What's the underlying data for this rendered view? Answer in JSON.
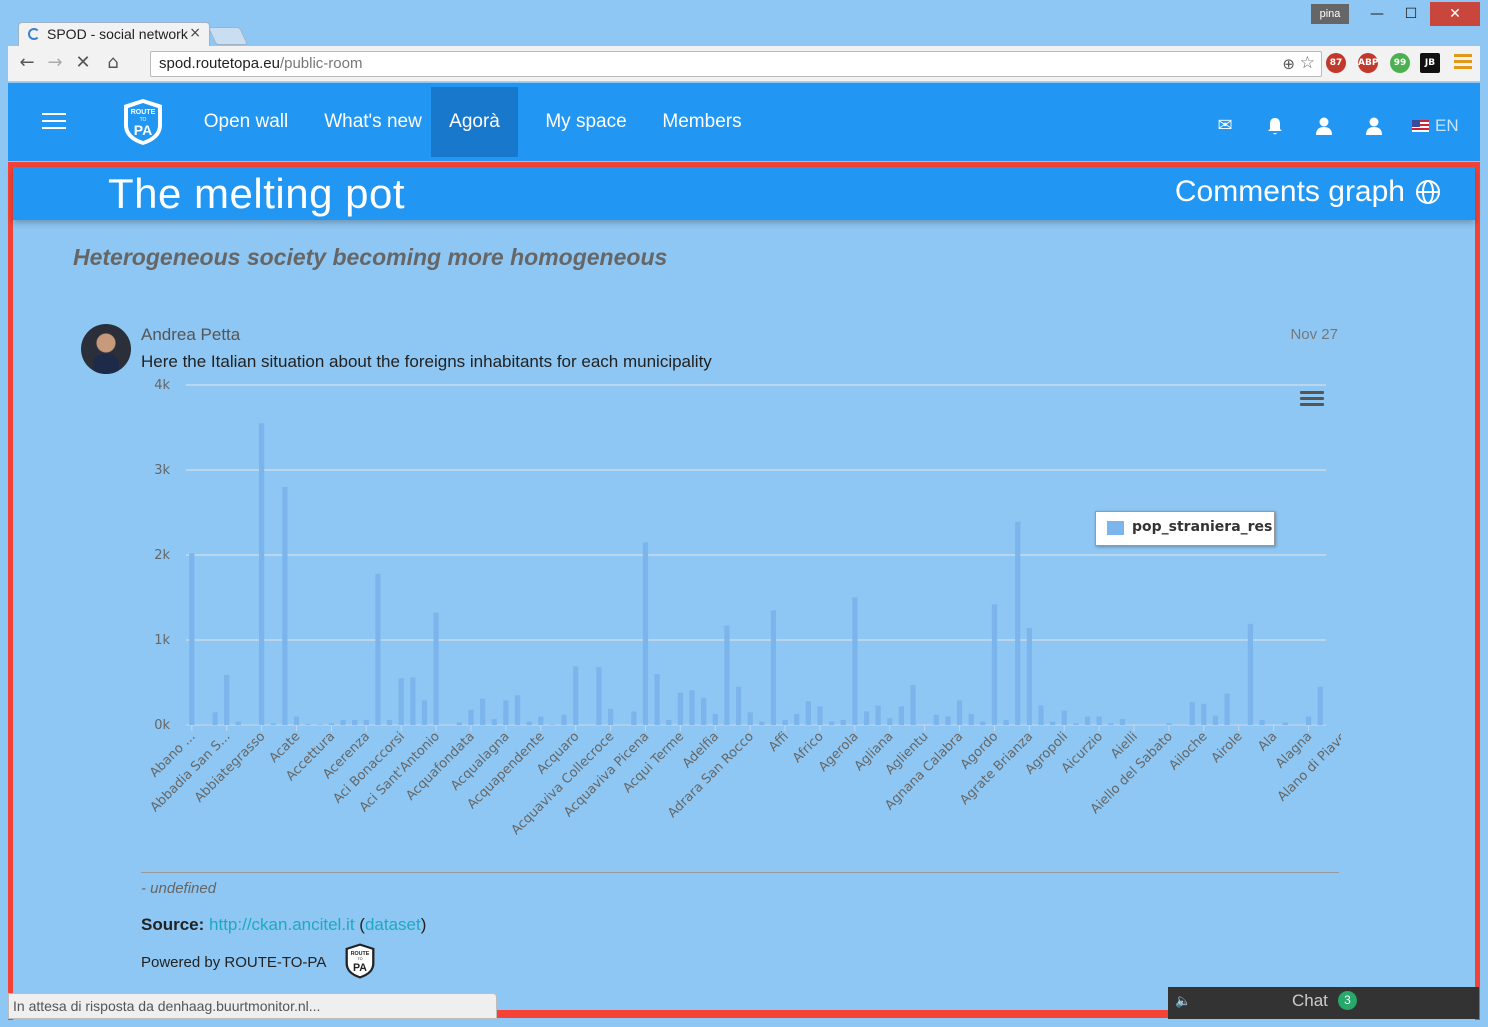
{
  "browser": {
    "tab_title": "SPOD - social network",
    "tab_close": "×",
    "profile": "pina",
    "min": "—",
    "max": "☐",
    "close": "✕",
    "back": "←",
    "forward": "→",
    "reload": "✕",
    "home": "⌂",
    "url_host": "spod.routetopa.eu",
    "url_path": "/public-room",
    "extensions": [
      {
        "name": "extension-87-icon",
        "label": "87",
        "color": "#c0392b"
      },
      {
        "name": "adblock-icon",
        "label": "ABP",
        "color": "#c0392b"
      },
      {
        "name": "evernote-icon",
        "label": "99",
        "color": "#4caf50"
      },
      {
        "name": "jb-icon",
        "label": "JB",
        "color": "#111111"
      }
    ]
  },
  "header": {
    "nav": [
      "Open wall",
      "What's new",
      "Agorà",
      "My space",
      "Members"
    ],
    "active_index": 2,
    "lang": "EN"
  },
  "room": {
    "title": "The melting pot",
    "graph_label": "Comments graph",
    "subtitle": "Heterogeneous society becoming more homogeneous"
  },
  "post": {
    "author": "Andrea Petta",
    "date": "Nov 27",
    "text": "Here the Italian situation about the foreigns inhabitants for each municipality"
  },
  "chart_data": {
    "type": "bar",
    "y_ticks": [
      "0k",
      "1k",
      "2k",
      "3k",
      "4k"
    ],
    "ylim": [
      0,
      4000
    ],
    "grid": true,
    "legend_position": "top-right",
    "colors": {
      "bar": "#7cb5ec"
    },
    "series": [
      {
        "name": "pop_straniera_res",
        "values": [
          2020,
          0,
          150,
          590,
          40,
          0,
          3550,
          20,
          2800,
          100,
          10,
          5,
          20,
          60,
          60,
          60,
          1780,
          60,
          550,
          560,
          290,
          1320,
          0,
          30,
          180,
          310,
          70,
          290,
          350,
          40,
          100,
          5,
          120,
          690,
          0,
          680,
          190,
          0,
          160,
          2150,
          600,
          60,
          380,
          410,
          320,
          130,
          1170,
          450,
          150,
          40,
          1350,
          60,
          130,
          280,
          220,
          40,
          60,
          1500,
          160,
          230,
          80,
          220,
          470,
          0,
          120,
          100,
          290,
          130,
          40,
          1420,
          60,
          2390,
          1140,
          230,
          40,
          170,
          20,
          100,
          100,
          20,
          70,
          0,
          0,
          0,
          20,
          0,
          270,
          250,
          110,
          370,
          0,
          1190,
          60,
          0,
          30,
          0,
          100,
          450
        ]
      }
    ],
    "x_tick_labels": [
      {
        "i": 0,
        "label": "Abano ..."
      },
      {
        "i": 3,
        "label": "Abbadia San S..."
      },
      {
        "i": 6,
        "label": "Abbiategrasso"
      },
      {
        "i": 9,
        "label": "Acate"
      },
      {
        "i": 12,
        "label": "Accettura"
      },
      {
        "i": 15,
        "label": "Acerenza"
      },
      {
        "i": 18,
        "label": "Aci Bonaccorsi"
      },
      {
        "i": 21,
        "label": "Aci Sant'Antonio"
      },
      {
        "i": 24,
        "label": "Acquafondata"
      },
      {
        "i": 27,
        "label": "Acqualagna"
      },
      {
        "i": 30,
        "label": "Acquapendente"
      },
      {
        "i": 33,
        "label": "Acquaro"
      },
      {
        "i": 36,
        "label": "Acquaviva Collecroce"
      },
      {
        "i": 39,
        "label": "Acquaviva Picena"
      },
      {
        "i": 42,
        "label": "Acqui Terme"
      },
      {
        "i": 45,
        "label": "Adelfia"
      },
      {
        "i": 48,
        "label": "Adrara San Rocco"
      },
      {
        "i": 51,
        "label": "Affi"
      },
      {
        "i": 54,
        "label": "Africo"
      },
      {
        "i": 57,
        "label": "Agerola"
      },
      {
        "i": 60,
        "label": "Agliana"
      },
      {
        "i": 63,
        "label": "Aglientu"
      },
      {
        "i": 66,
        "label": "Agnana Calabra"
      },
      {
        "i": 69,
        "label": "Agordo"
      },
      {
        "i": 72,
        "label": "Agrate Brianza"
      },
      {
        "i": 75,
        "label": "Agropoli"
      },
      {
        "i": 78,
        "label": "Aicurzio"
      },
      {
        "i": 81,
        "label": "Aielli"
      },
      {
        "i": 84,
        "label": "Aiello del Sabato"
      },
      {
        "i": 87,
        "label": "Ailoche"
      },
      {
        "i": 90,
        "label": "Airole"
      },
      {
        "i": 93,
        "label": "Ala"
      },
      {
        "i": 96,
        "label": "Alagna"
      },
      {
        "i": 99,
        "label": "Alano di Piave"
      }
    ]
  },
  "footer": {
    "caption": "- undefined",
    "source_label": "Source:",
    "source_link": "http://ckan.ancitel.it",
    "dataset_open": " (",
    "dataset_link": "dataset",
    "dataset_close": ")",
    "powered": "Powered by ROUTE-TO-PA",
    "status": "In attesa di risposta da denhaag.buurtmonitor.nl...",
    "chat_label": "Chat",
    "chat_count": "3"
  }
}
